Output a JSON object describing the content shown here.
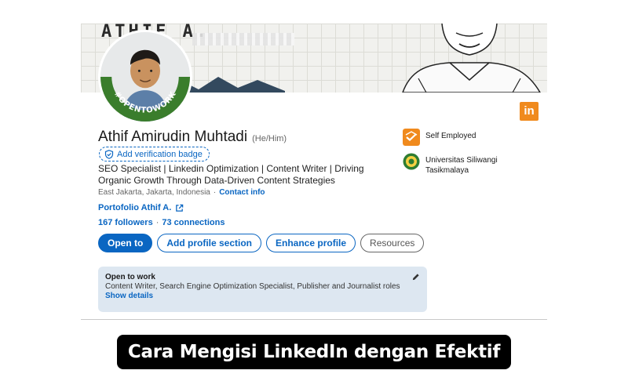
{
  "banner": {
    "name_text": "ATHIF A."
  },
  "profile": {
    "open_to_work_badge": "#OPENTOWORK",
    "name": "Athif Amirudin Muhtadi",
    "pronouns": "(He/Him)",
    "verify_label": "Add verification badge",
    "headline": "SEO Specialist | Linkedin Optimization | Content Writer | Driving Organic Growth Through Data-Driven Content Strategies",
    "location": "East Jakarta, Jakarta, Indonesia",
    "separator": "·",
    "contact_info": "Contact info",
    "portfolio": "Portofolio Athif A.",
    "followers": "167 followers",
    "connections": "73 connections"
  },
  "actions": {
    "open_to": "Open to",
    "add_section": "Add profile section",
    "enhance": "Enhance profile",
    "resources": "Resources"
  },
  "open_to_work": {
    "title": "Open to work",
    "roles": "Content Writer, Search Engine Optimization Specialist, Publisher and Journalist roles",
    "show_details": "Show details"
  },
  "experience": [
    {
      "label": "Self Employed"
    },
    {
      "label": "Universitas Siliwangi Tasikmalaya"
    }
  ],
  "brand": {
    "logo_text": "in",
    "linkedin_blue": "#0a66c2",
    "otw_green": "#3a7d2c",
    "logo_orange": "#f08a1d"
  },
  "caption": "Cara Mengisi LinkedIn dengan Efektif"
}
